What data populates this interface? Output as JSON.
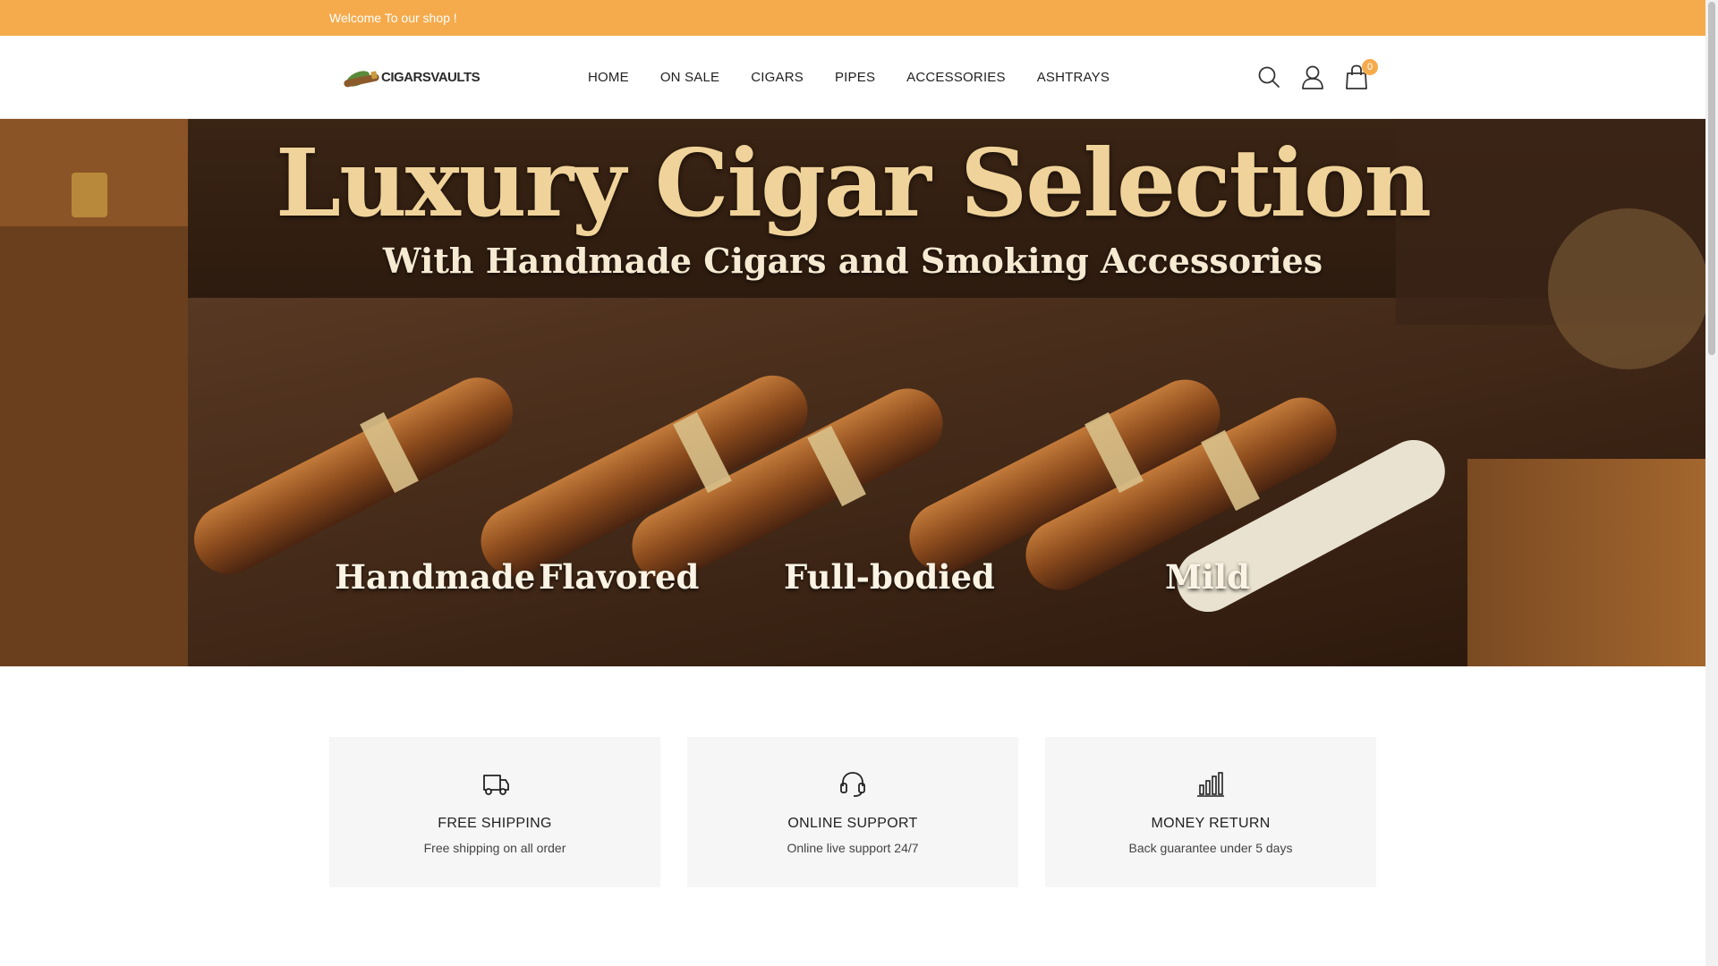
{
  "topbar": {
    "welcome": "Welcome To our shop !"
  },
  "header": {
    "logo_text": "CIGARSVAULTS",
    "nav": [
      "HOME",
      "ON SALE",
      "CIGARS",
      "PIPES",
      "ACCESSORIES",
      "ASHTRAYS"
    ],
    "icons": [
      "search-icon",
      "user-icon",
      "cart-icon"
    ],
    "cart_count": "0"
  },
  "hero": {
    "title": "Luxury Cigar Selection",
    "subtitle": "With Handmade Cigars and Smoking Accessories",
    "categories": [
      "Handmade",
      "Flavored",
      "Full-bodied",
      "Mild"
    ]
  },
  "features": [
    {
      "icon": "truck-icon",
      "title": "FREE SHIPPING",
      "desc": "Free shipping on all order"
    },
    {
      "icon": "headset-icon",
      "title": "ONLINE SUPPORT",
      "desc": "Online live support 24/7"
    },
    {
      "icon": "bar-chart-icon",
      "title": "MONEY RETURN",
      "desc": "Back guarantee under 5 days"
    }
  ],
  "colors": {
    "accent": "#f5ab4c",
    "feature_bg": "#f6f6f6"
  }
}
